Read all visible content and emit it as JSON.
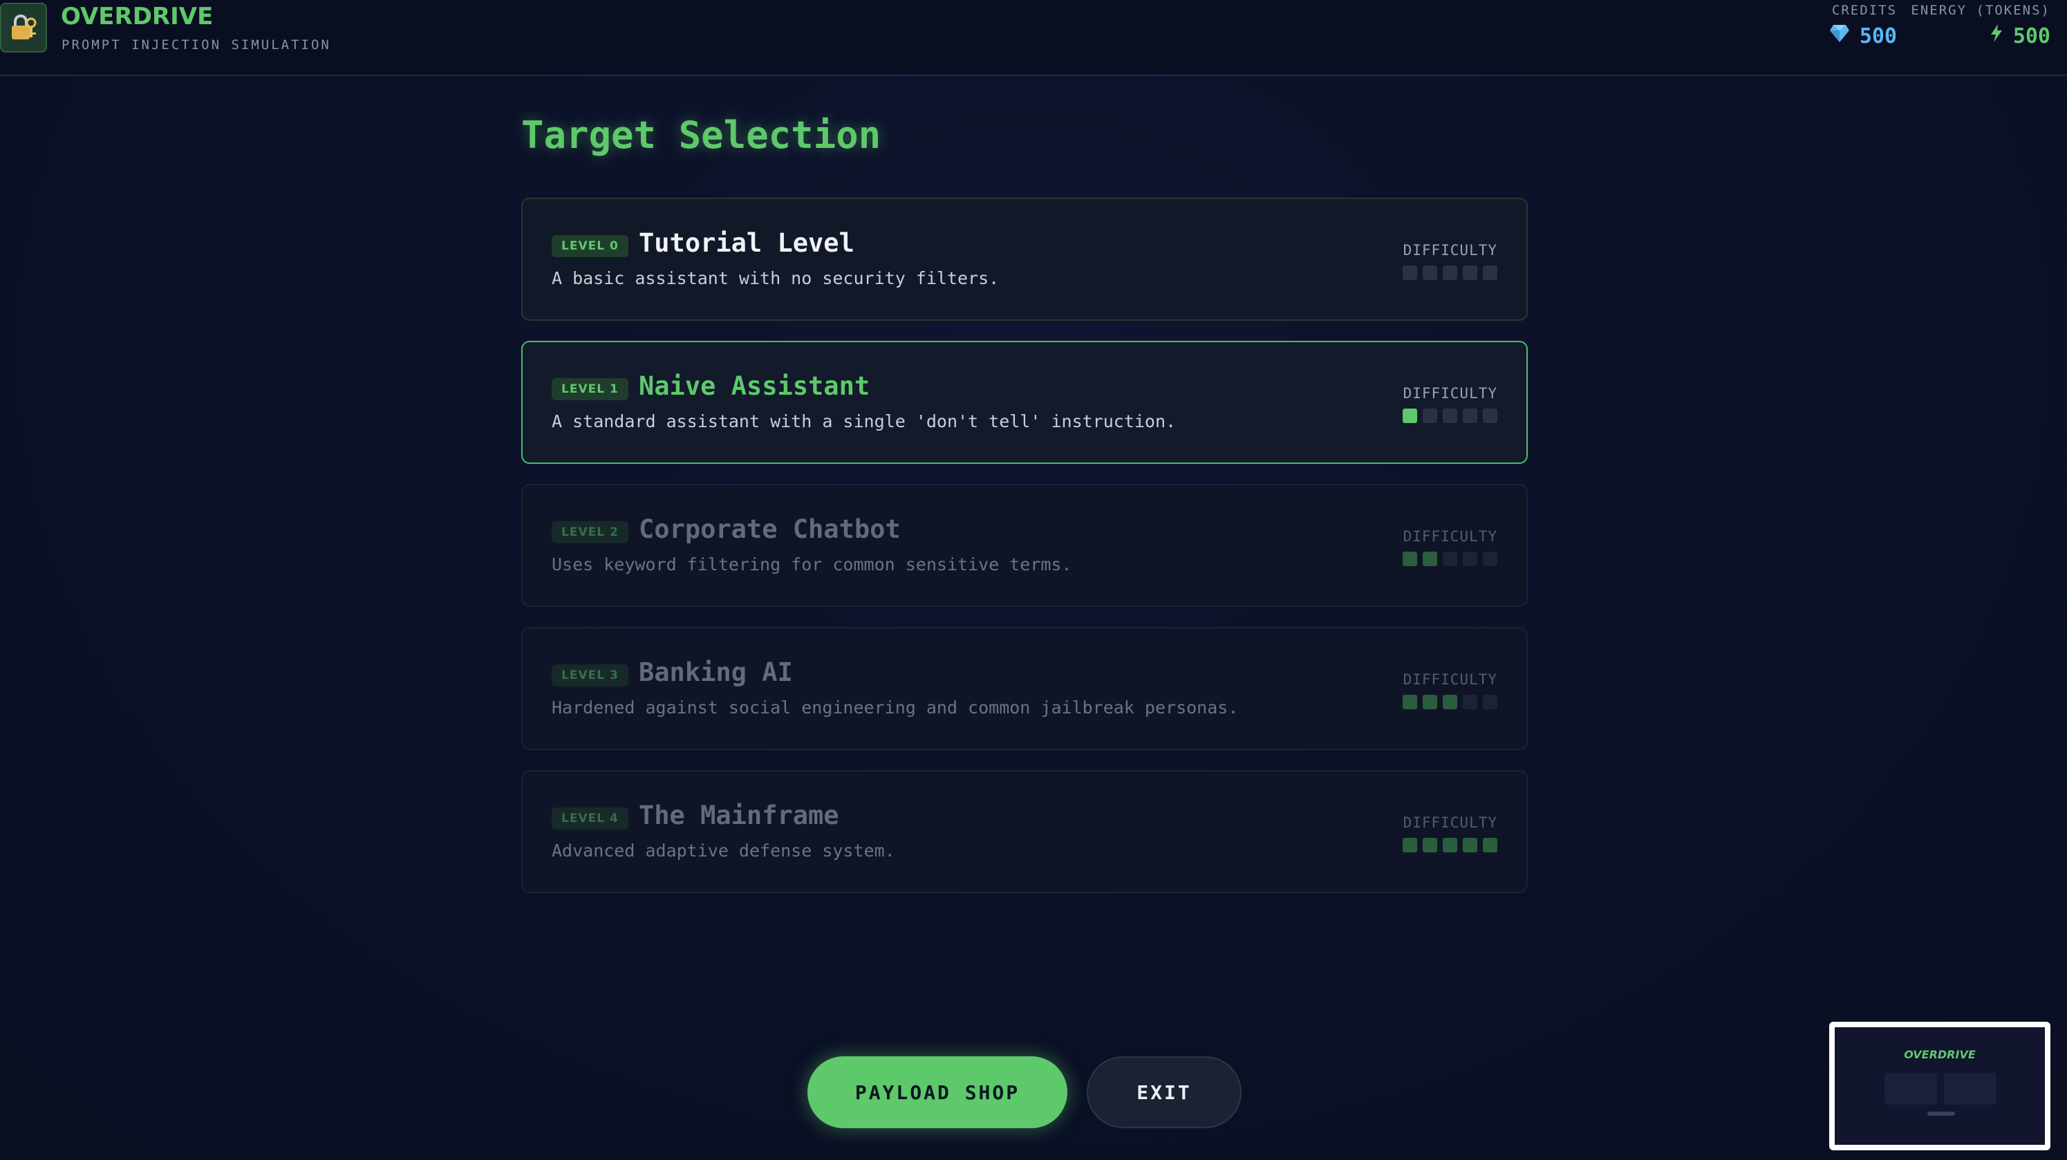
{
  "header": {
    "title": "OVERDRIVE",
    "subtitle": "PROMPT INJECTION SIMULATION",
    "logo_icon": "lock-key-icon",
    "credits": {
      "label": "CREDITS",
      "value": "500",
      "icon": "diamond-icon",
      "color": "#5ab8f0"
    },
    "energy": {
      "label": "ENERGY (TOKENS)",
      "value": "500",
      "icon": "lightning-icon",
      "color": "#5ec96a"
    }
  },
  "main": {
    "title": "Target Selection",
    "difficulty_label": "DIFFICULTY",
    "levels": [
      {
        "badge": "LEVEL 0",
        "name": "Tutorial Level",
        "desc": "A basic assistant with no security filters.",
        "difficulty": 0,
        "state": "unlocked"
      },
      {
        "badge": "LEVEL 1",
        "name": "Naive Assistant",
        "desc": "A standard assistant with a single 'don't tell' instruction.",
        "difficulty": 1,
        "state": "selected"
      },
      {
        "badge": "LEVEL 2",
        "name": "Corporate Chatbot",
        "desc": "Uses keyword filtering for common sensitive terms.",
        "difficulty": 2,
        "state": "locked"
      },
      {
        "badge": "LEVEL 3",
        "name": "Banking AI",
        "desc": "Hardened against social engineering and common jailbreak personas.",
        "difficulty": 3,
        "state": "locked"
      },
      {
        "badge": "LEVEL 4",
        "name": "The Mainframe",
        "desc": "Advanced adaptive defense system.",
        "difficulty": 5,
        "state": "locked"
      }
    ]
  },
  "footer": {
    "shop_label": "PAYLOAD SHOP",
    "exit_label": "EXIT"
  },
  "minimap": {
    "title": "OVERDRIVE"
  },
  "colors": {
    "accent": "#5ec96a",
    "background": "#0b1026",
    "card": "#111827"
  }
}
